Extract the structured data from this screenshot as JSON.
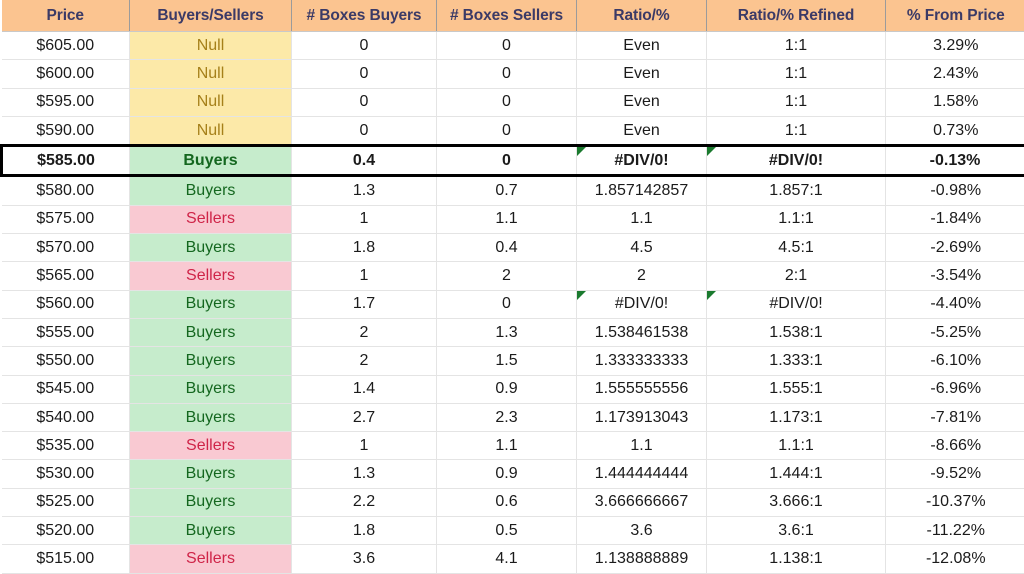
{
  "table": {
    "columns": [
      "Price",
      "Buyers/Sellers",
      "# Boxes Buyers",
      "# Boxes Sellers",
      "Ratio/%",
      "Ratio/% Refined",
      "% From Price"
    ],
    "colors": {
      "header_fill": "#fbc490",
      "header_text": "#3b3a66",
      "null_fill": "#fce9a8",
      "null_text": "#a6801a",
      "buyers_fill": "#c6eccc",
      "buyers_text": "#14671f",
      "sellers_fill": "#f9c9d2",
      "sellers_text": "#cf2448",
      "focus_border": "#000000",
      "error_flag": "#1a7a2e",
      "grid_line": "#e4e4e4"
    },
    "rows": [
      {
        "price": "$605.00",
        "status": "Null",
        "status_kind": "null",
        "boxes_buyers": "0",
        "boxes_sellers": "0",
        "ratio": "Even",
        "ratio_refined": "1:1",
        "pct_from_price": "3.29%",
        "focus": false,
        "ratio_error": false,
        "ratio_refined_error": false
      },
      {
        "price": "$600.00",
        "status": "Null",
        "status_kind": "null",
        "boxes_buyers": "0",
        "boxes_sellers": "0",
        "ratio": "Even",
        "ratio_refined": "1:1",
        "pct_from_price": "2.43%",
        "focus": false,
        "ratio_error": false,
        "ratio_refined_error": false
      },
      {
        "price": "$595.00",
        "status": "Null",
        "status_kind": "null",
        "boxes_buyers": "0",
        "boxes_sellers": "0",
        "ratio": "Even",
        "ratio_refined": "1:1",
        "pct_from_price": "1.58%",
        "focus": false,
        "ratio_error": false,
        "ratio_refined_error": false
      },
      {
        "price": "$590.00",
        "status": "Null",
        "status_kind": "null",
        "boxes_buyers": "0",
        "boxes_sellers": "0",
        "ratio": "Even",
        "ratio_refined": "1:1",
        "pct_from_price": "0.73%",
        "focus": false,
        "ratio_error": false,
        "ratio_refined_error": false
      },
      {
        "price": "$585.00",
        "status": "Buyers",
        "status_kind": "buyers",
        "boxes_buyers": "0.4",
        "boxes_sellers": "0",
        "ratio": "#DIV/0!",
        "ratio_refined": "#DIV/0!",
        "pct_from_price": "-0.13%",
        "focus": true,
        "ratio_error": true,
        "ratio_refined_error": true
      },
      {
        "price": "$580.00",
        "status": "Buyers",
        "status_kind": "buyers",
        "boxes_buyers": "1.3",
        "boxes_sellers": "0.7",
        "ratio": "1.857142857",
        "ratio_refined": "1.857:1",
        "pct_from_price": "-0.98%",
        "focus": false,
        "ratio_error": false,
        "ratio_refined_error": false
      },
      {
        "price": "$575.00",
        "status": "Sellers",
        "status_kind": "sellers",
        "boxes_buyers": "1",
        "boxes_sellers": "1.1",
        "ratio": "1.1",
        "ratio_refined": "1.1:1",
        "pct_from_price": "-1.84%",
        "focus": false,
        "ratio_error": false,
        "ratio_refined_error": false
      },
      {
        "price": "$570.00",
        "status": "Buyers",
        "status_kind": "buyers",
        "boxes_buyers": "1.8",
        "boxes_sellers": "0.4",
        "ratio": "4.5",
        "ratio_refined": "4.5:1",
        "pct_from_price": "-2.69%",
        "focus": false,
        "ratio_error": false,
        "ratio_refined_error": false
      },
      {
        "price": "$565.00",
        "status": "Sellers",
        "status_kind": "sellers",
        "boxes_buyers": "1",
        "boxes_sellers": "2",
        "ratio": "2",
        "ratio_refined": "2:1",
        "pct_from_price": "-3.54%",
        "focus": false,
        "ratio_error": false,
        "ratio_refined_error": false
      },
      {
        "price": "$560.00",
        "status": "Buyers",
        "status_kind": "buyers",
        "boxes_buyers": "1.7",
        "boxes_sellers": "0",
        "ratio": "#DIV/0!",
        "ratio_refined": "#DIV/0!",
        "pct_from_price": "-4.40%",
        "focus": false,
        "ratio_error": true,
        "ratio_refined_error": true
      },
      {
        "price": "$555.00",
        "status": "Buyers",
        "status_kind": "buyers",
        "boxes_buyers": "2",
        "boxes_sellers": "1.3",
        "ratio": "1.538461538",
        "ratio_refined": "1.538:1",
        "pct_from_price": "-5.25%",
        "focus": false,
        "ratio_error": false,
        "ratio_refined_error": false
      },
      {
        "price": "$550.00",
        "status": "Buyers",
        "status_kind": "buyers",
        "boxes_buyers": "2",
        "boxes_sellers": "1.5",
        "ratio": "1.333333333",
        "ratio_refined": "1.333:1",
        "pct_from_price": "-6.10%",
        "focus": false,
        "ratio_error": false,
        "ratio_refined_error": false
      },
      {
        "price": "$545.00",
        "status": "Buyers",
        "status_kind": "buyers",
        "boxes_buyers": "1.4",
        "boxes_sellers": "0.9",
        "ratio": "1.555555556",
        "ratio_refined": "1.555:1",
        "pct_from_price": "-6.96%",
        "focus": false,
        "ratio_error": false,
        "ratio_refined_error": false
      },
      {
        "price": "$540.00",
        "status": "Buyers",
        "status_kind": "buyers",
        "boxes_buyers": "2.7",
        "boxes_sellers": "2.3",
        "ratio": "1.173913043",
        "ratio_refined": "1.173:1",
        "pct_from_price": "-7.81%",
        "focus": false,
        "ratio_error": false,
        "ratio_refined_error": false
      },
      {
        "price": "$535.00",
        "status": "Sellers",
        "status_kind": "sellers",
        "boxes_buyers": "1",
        "boxes_sellers": "1.1",
        "ratio": "1.1",
        "ratio_refined": "1.1:1",
        "pct_from_price": "-8.66%",
        "focus": false,
        "ratio_error": false,
        "ratio_refined_error": false
      },
      {
        "price": "$530.00",
        "status": "Buyers",
        "status_kind": "buyers",
        "boxes_buyers": "1.3",
        "boxes_sellers": "0.9",
        "ratio": "1.444444444",
        "ratio_refined": "1.444:1",
        "pct_from_price": "-9.52%",
        "focus": false,
        "ratio_error": false,
        "ratio_refined_error": false
      },
      {
        "price": "$525.00",
        "status": "Buyers",
        "status_kind": "buyers",
        "boxes_buyers": "2.2",
        "boxes_sellers": "0.6",
        "ratio": "3.666666667",
        "ratio_refined": "3.666:1",
        "pct_from_price": "-10.37%",
        "focus": false,
        "ratio_error": false,
        "ratio_refined_error": false
      },
      {
        "price": "$520.00",
        "status": "Buyers",
        "status_kind": "buyers",
        "boxes_buyers": "1.8",
        "boxes_sellers": "0.5",
        "ratio": "3.6",
        "ratio_refined": "3.6:1",
        "pct_from_price": "-11.22%",
        "focus": false,
        "ratio_error": false,
        "ratio_refined_error": false
      },
      {
        "price": "$515.00",
        "status": "Sellers",
        "status_kind": "sellers",
        "boxes_buyers": "3.6",
        "boxes_sellers": "4.1",
        "ratio": "1.138888889",
        "ratio_refined": "1.138:1",
        "pct_from_price": "-12.08%",
        "focus": false,
        "ratio_error": false,
        "ratio_refined_error": false
      }
    ]
  }
}
